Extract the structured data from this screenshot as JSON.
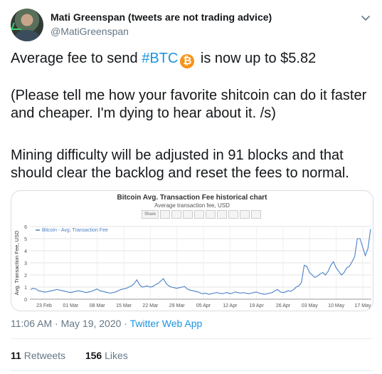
{
  "author": {
    "name": "Mati Greenspan (tweets are not trading advice)",
    "handle": "@MatiGreenspan"
  },
  "tweet": {
    "line1_prefix": "Average fee to send ",
    "hashtag": "#BTC",
    "coin_glyph": "₿",
    "line1_suffix": " is now up to $5.82",
    "para2": "(Please tell me how your favorite shitcoin can do it faster and cheaper. I'm dying to hear about it. /s)",
    "para3": "Mining difficulty will be adjusted in 91 blocks and that should clear the backlog and reset the fees to normal."
  },
  "chart_data": {
    "type": "line",
    "title": "Bitcoin Avg. Transaction Fee historical chart",
    "subtitle": "Average transaction fee, USD",
    "ylabel": "Avg. Transaction Fee, USD",
    "xlabel": "",
    "ylim": [
      0,
      6
    ],
    "yticks": [
      0,
      1,
      2,
      3,
      4,
      5,
      6
    ],
    "grid": true,
    "legend_position": "top-left",
    "x_tick_labels": [
      "23 Feb",
      "01 Mar",
      "08 Mar",
      "15 Mar",
      "22 Mar",
      "29 Mar",
      "05 Apr",
      "12 Apr",
      "19 Apr",
      "26 Apr",
      "03 May",
      "10 May",
      "17 May"
    ],
    "series": [
      {
        "name": "Bitcoin - Avg. Transaction Fee",
        "color": "#4a80c8",
        "x_start": "2020-02-18",
        "values": [
          0.8,
          0.9,
          0.85,
          0.7,
          0.65,
          0.6,
          0.6,
          0.65,
          0.7,
          0.75,
          0.8,
          0.75,
          0.7,
          0.65,
          0.6,
          0.55,
          0.6,
          0.65,
          0.7,
          0.65,
          0.6,
          0.55,
          0.6,
          0.65,
          0.75,
          0.85,
          0.7,
          0.65,
          0.6,
          0.55,
          0.5,
          0.55,
          0.6,
          0.7,
          0.8,
          0.85,
          0.9,
          1.0,
          1.1,
          1.3,
          1.6,
          1.2,
          1.0,
          1.05,
          1.1,
          1.0,
          1.05,
          1.2,
          1.3,
          1.5,
          1.7,
          1.3,
          1.1,
          1.0,
          0.95,
          0.9,
          0.95,
          1.0,
          1.05,
          0.85,
          0.75,
          0.7,
          0.65,
          0.6,
          0.5,
          0.45,
          0.5,
          0.4,
          0.45,
          0.5,
          0.55,
          0.5,
          0.45,
          0.5,
          0.55,
          0.45,
          0.5,
          0.6,
          0.55,
          0.5,
          0.55,
          0.5,
          0.45,
          0.5,
          0.55,
          0.6,
          0.5,
          0.45,
          0.4,
          0.45,
          0.5,
          0.55,
          0.7,
          0.8,
          0.6,
          0.55,
          0.6,
          0.7,
          0.65,
          0.8,
          1.0,
          1.1,
          1.4,
          2.8,
          2.7,
          2.2,
          2.0,
          1.8,
          1.9,
          2.1,
          2.2,
          2.0,
          2.3,
          2.8,
          3.1,
          2.6,
          2.3,
          2.0,
          2.2,
          2.6,
          2.7,
          3.1,
          3.5,
          5.0,
          5.0,
          4.3,
          3.6,
          4.2,
          5.8
        ]
      }
    ]
  },
  "meta": {
    "time": "11:06 AM",
    "separator": " · ",
    "date": "May 19, 2020",
    "source": "Twitter Web App"
  },
  "stats": {
    "retweets_count": "11",
    "retweets_label": "Retweets",
    "likes_count": "156",
    "likes_label": "Likes"
  },
  "icons": {
    "more": "chevron-down-icon",
    "coin": "bitcoin-icon"
  },
  "colors": {
    "link": "#1b95e0",
    "secondary": "#657786",
    "coin": "#f7931a"
  }
}
